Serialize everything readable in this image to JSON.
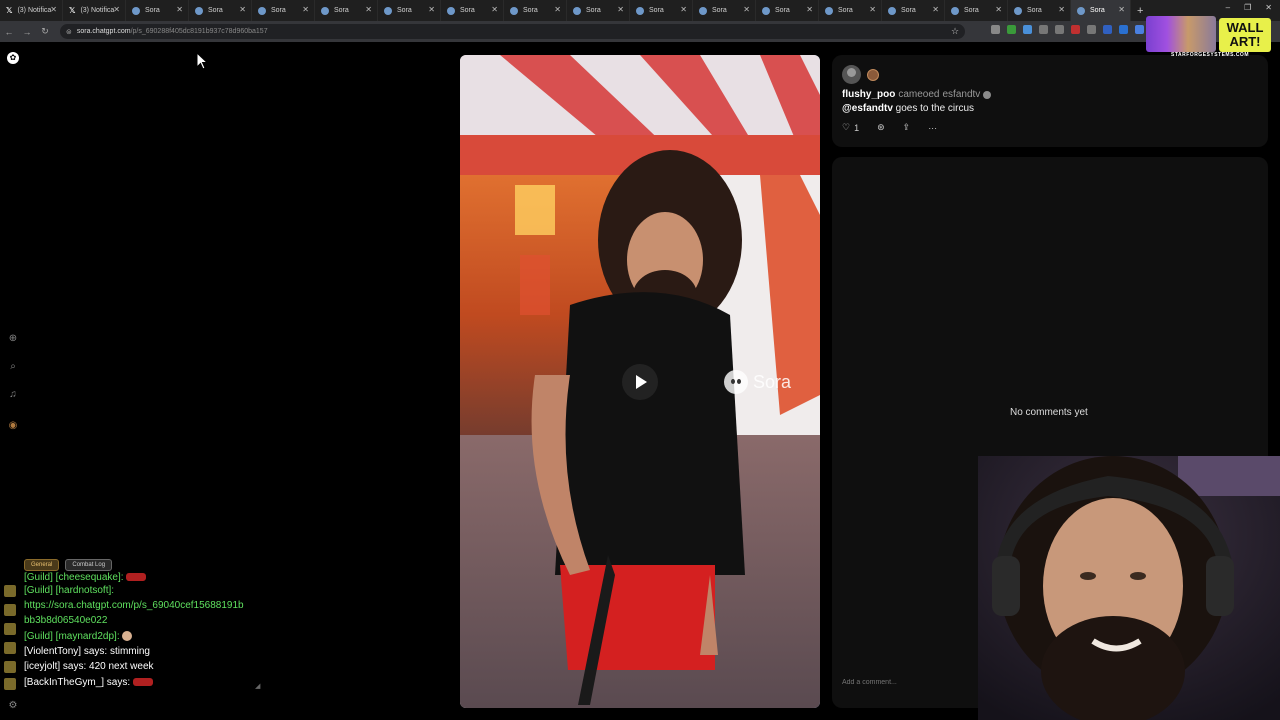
{
  "browser": {
    "tabs": [
      {
        "label": "(3) Notifica",
        "icon": "x-logo-icon"
      },
      {
        "label": "(3) Notifica",
        "icon": "x-logo-icon"
      },
      {
        "label": "Sora",
        "icon": "sora-icon"
      },
      {
        "label": "Sora",
        "icon": "sora-icon"
      },
      {
        "label": "Sora",
        "icon": "sora-icon"
      },
      {
        "label": "Sora",
        "icon": "sora-icon"
      },
      {
        "label": "Sora",
        "icon": "sora-icon"
      },
      {
        "label": "Sora",
        "icon": "sora-icon"
      },
      {
        "label": "Sora",
        "icon": "sora-icon"
      },
      {
        "label": "Sora",
        "icon": "sora-icon"
      },
      {
        "label": "Sora",
        "icon": "sora-icon"
      },
      {
        "label": "Sora",
        "icon": "sora-icon"
      },
      {
        "label": "Sora",
        "icon": "sora-icon"
      },
      {
        "label": "Sora",
        "icon": "sora-icon"
      },
      {
        "label": "Sora",
        "icon": "sora-icon"
      },
      {
        "label": "Sora",
        "icon": "sora-icon"
      },
      {
        "label": "Sora",
        "icon": "sora-icon"
      },
      {
        "label": "Sora",
        "icon": "sora-icon",
        "active": true
      }
    ],
    "url_domain": "sora.chatgpt.com",
    "url_path": "/p/s_690288f405dc8191b937c78d960ba157"
  },
  "post": {
    "author": "flushy_poo",
    "cameo_text": "cameoed",
    "cameo_user": "esfandtv",
    "caption_mention": "@esfandtv",
    "caption_text": "goes to the circus",
    "likes": "1",
    "watermark": "Sora"
  },
  "comments": {
    "empty_text": "No comments yet",
    "input_placeholder": "Add a comment..."
  },
  "chat": {
    "tabs": [
      "General",
      "Combat Log"
    ],
    "lines": [
      {
        "kind": "guild",
        "text": "[Guild] [cheesequake]:"
      },
      {
        "kind": "guild",
        "text": "[Guild] [hardnotsoft]:"
      },
      {
        "kind": "guild",
        "text": "https://sora.chatgpt.com/p/s_69040cef15688191b"
      },
      {
        "kind": "guild",
        "text": "bb3b8d06540e022"
      },
      {
        "kind": "guild",
        "text": "[Guild] [maynard2dp]:"
      },
      {
        "kind": "say",
        "text": "[ViolentTony] says:  stimming"
      },
      {
        "kind": "say",
        "text": "[iceyjolt] says: 420 next week"
      },
      {
        "kind": "say",
        "text": "[BackInTheGym_] says:"
      }
    ]
  },
  "brand": {
    "title": "WALL ART!",
    "subtitle": "STARFORGESYSTEMS.COM"
  },
  "colors": {
    "background": "#000000",
    "card": "#0f0f0f",
    "guild_chat": "#5fe05f",
    "brand_yellow": "#e8f04a"
  }
}
